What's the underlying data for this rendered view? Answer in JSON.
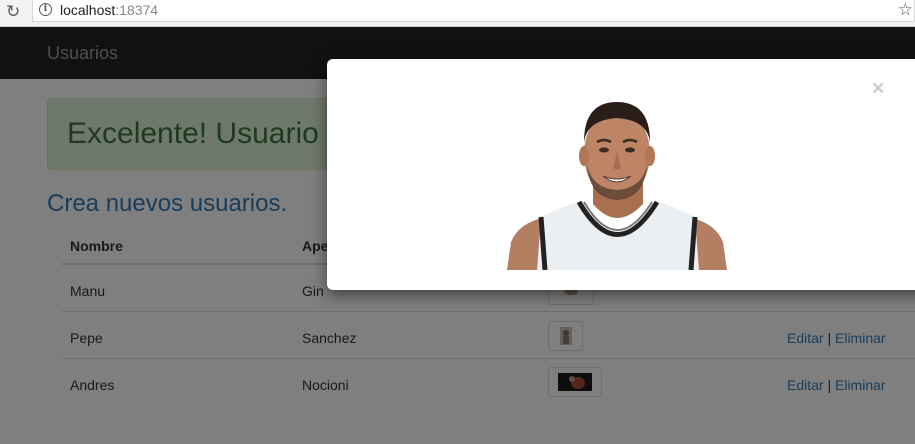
{
  "browser": {
    "url_host": "localhost",
    "url_port": ":18374"
  },
  "navbar": {
    "brand": "Usuarios"
  },
  "alert": {
    "text": "Excelente! Usuario"
  },
  "page": {
    "subtitle": "Crea nuevos usuarios."
  },
  "table": {
    "headers": {
      "nombre": "Nombre",
      "apellido": "Ape"
    },
    "rows": [
      {
        "nombre": "Manu",
        "apellido": "Gin"
      },
      {
        "nombre": "Pepe",
        "apellido": "Sanchez",
        "edit": "Editar",
        "sep": "|",
        "delete": "Eliminar"
      },
      {
        "nombre": "Andres",
        "apellido": "Nocioni",
        "edit": "Editar",
        "sep": "|",
        "delete": "Eliminar"
      }
    ]
  },
  "modal": {
    "close": "×"
  },
  "colors": {
    "navbar": "#222222",
    "link": "#337ab7",
    "alert_bg": "#dff0d8",
    "alert_text": "#3c763d"
  },
  "icons": {
    "reload": "reload-icon",
    "info": "info-icon",
    "star": "star-icon",
    "close": "close-icon"
  }
}
